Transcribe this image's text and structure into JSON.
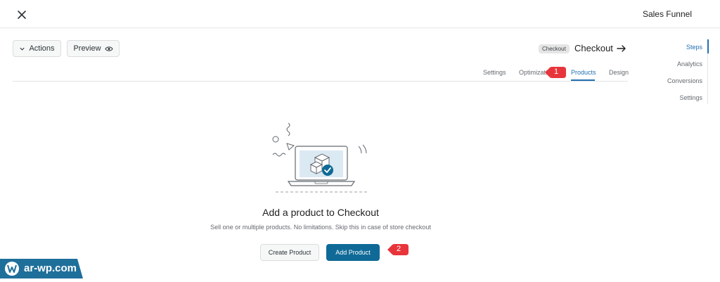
{
  "header": {
    "title": "Sales Funnel",
    "close_icon": "close-icon"
  },
  "toolbar": {
    "actions_label": "Actions",
    "preview_label": "Preview"
  },
  "step": {
    "badge": "Checkout",
    "title": "Checkout"
  },
  "tabs": [
    {
      "label": "Settings",
      "active": false
    },
    {
      "label": "Optimizations",
      "active": false
    },
    {
      "label": "Products",
      "active": true
    },
    {
      "label": "Design",
      "active": false
    }
  ],
  "side_nav": [
    {
      "label": "Steps",
      "active": true
    },
    {
      "label": "Analytics",
      "active": false
    },
    {
      "label": "Conversions",
      "active": false
    },
    {
      "label": "Settings",
      "active": false
    }
  ],
  "empty_state": {
    "heading": "Add a product to Checkout",
    "subtext": "Sell one or multiple products. No limitations. Skip this in case of store checkout",
    "create_label": "Create Product",
    "add_label": "Add Product"
  },
  "markers": [
    "1",
    "2"
  ],
  "watermark": "ar-wp.com",
  "colors": {
    "accent": "#2271b1",
    "primary_button": "#0f6a97",
    "marker": "#e8353b",
    "watermark_bg": "#1f6f9b"
  }
}
